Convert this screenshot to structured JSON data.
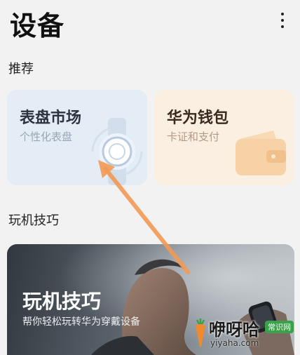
{
  "header": {
    "title": "设备",
    "more_icon": "more-vertical-icon"
  },
  "sections": {
    "recommend": "推荐",
    "tips": "玩机技巧"
  },
  "cards": [
    {
      "title": "表盘市场",
      "subtitle": "个性化表盘",
      "icon": "watch-icon",
      "color": "#e4ecf6"
    },
    {
      "title": "华为钱包",
      "subtitle": "卡证和支付",
      "icon": "wallet-icon",
      "color": "#fbefe2"
    }
  ],
  "banner": {
    "title": "玩机技巧",
    "subtitle": "帮你轻松玩转华为穿戴设备"
  },
  "watermark": {
    "text": "咿呀哈",
    "badge": "常识网",
    "url": "yiyaha.com"
  },
  "annotation": {
    "type": "arrow",
    "color": "#f29a55"
  }
}
